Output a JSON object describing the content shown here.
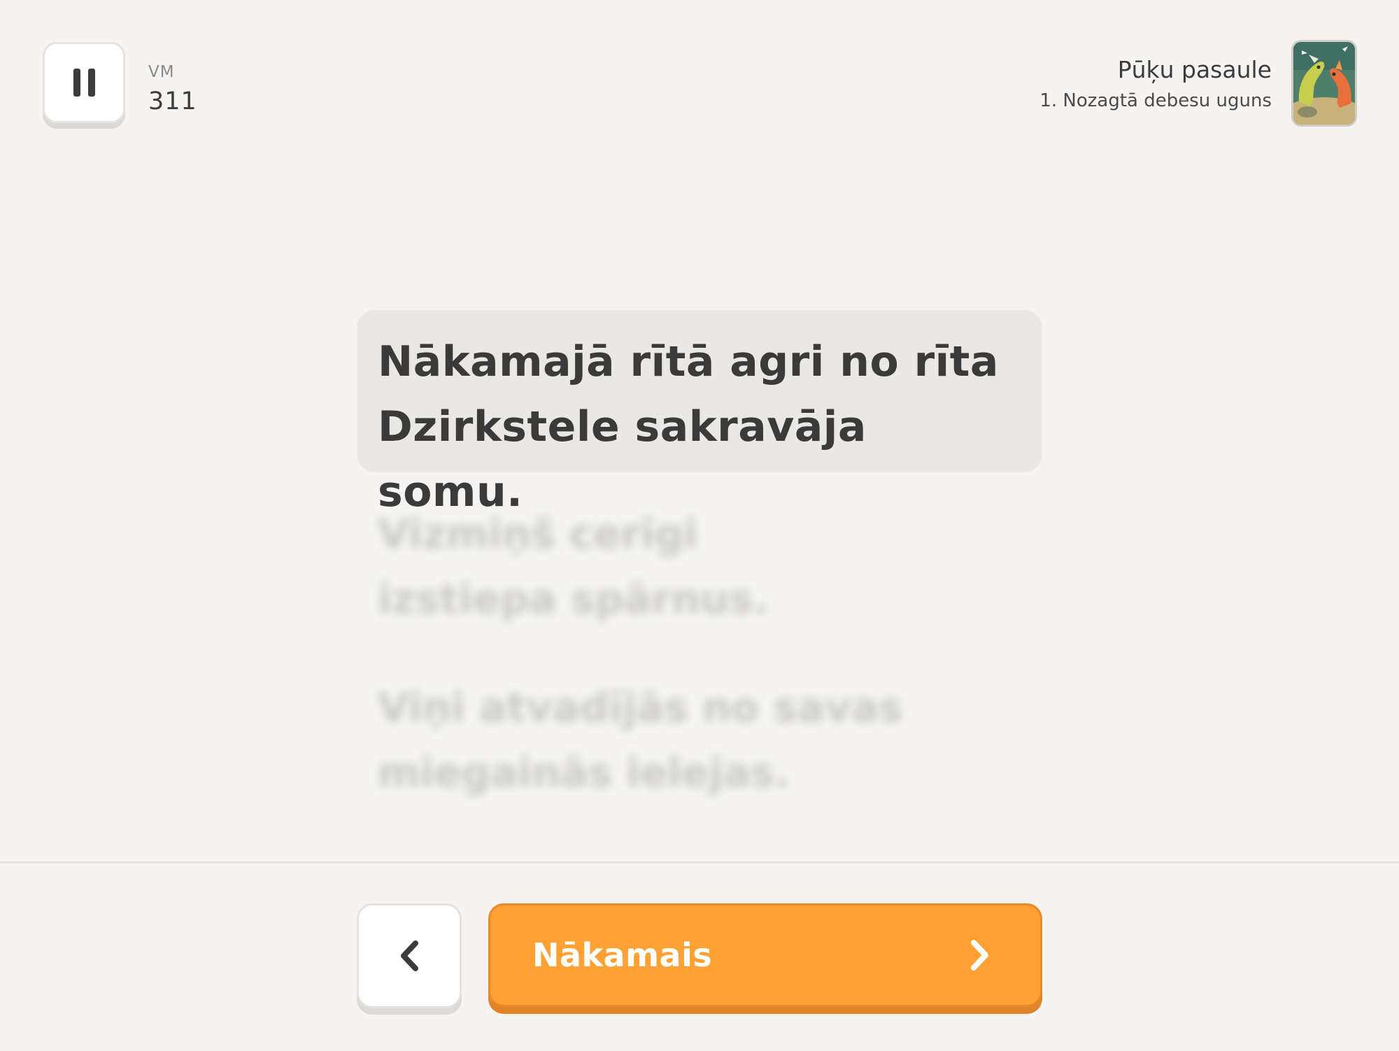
{
  "header": {
    "pause_icon": "pause-icon",
    "level_label": "VM",
    "level_value": "311",
    "story_title": "Pūķu pasaule",
    "story_chapter": "1. Nozagtā debesu uguns",
    "story_thumbnail_alt": "dragon-illustration"
  },
  "story": {
    "current_line": "Nākamajā rītā agri no rīta\nDzirkstele sakravāja somu.",
    "upcoming_lines": [
      "Vizmiņš cerīgi\nizstiepa spārnus.",
      "Viņi atvadījās no savas\nmiegainās ielejas."
    ]
  },
  "footer": {
    "back_icon": "chevron-left-icon",
    "next_label": "Nākamais",
    "next_icon": "chevron-right-icon"
  },
  "colors": {
    "background": "#f5f4f2",
    "accent": "#ffa134",
    "text": "#3c3c3c",
    "highlight": "#e9e8e5"
  }
}
